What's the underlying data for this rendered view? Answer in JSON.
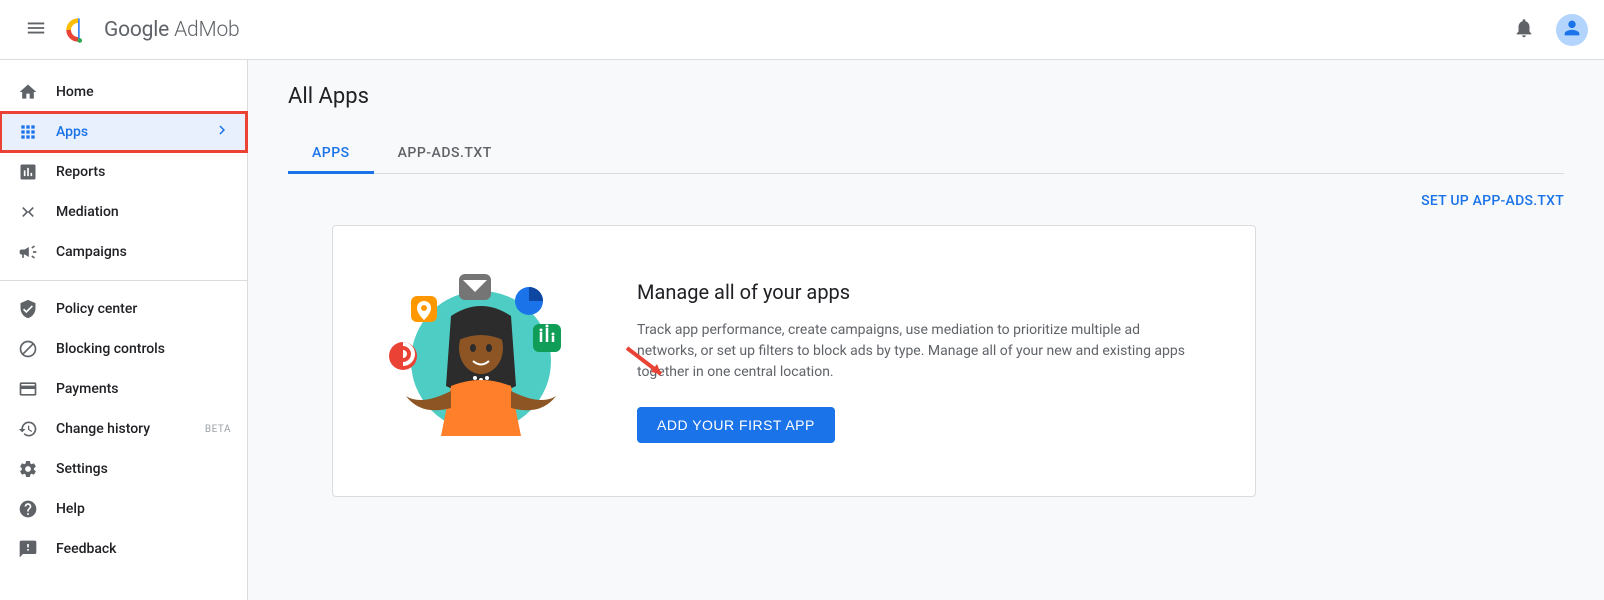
{
  "header": {
    "product_name_a": "Google",
    "product_name_b": "AdMob"
  },
  "sidebar": {
    "items": [
      {
        "label": "Home"
      },
      {
        "label": "Apps"
      },
      {
        "label": "Reports"
      },
      {
        "label": "Mediation"
      },
      {
        "label": "Campaigns"
      },
      {
        "label": "Policy center"
      },
      {
        "label": "Blocking controls"
      },
      {
        "label": "Payments"
      },
      {
        "label": "Change history",
        "badge": "BETA"
      },
      {
        "label": "Settings"
      },
      {
        "label": "Help"
      },
      {
        "label": "Feedback"
      }
    ]
  },
  "main": {
    "title": "All Apps",
    "tabs": [
      {
        "label": "APPS"
      },
      {
        "label": "APP-ADS.TXT"
      }
    ],
    "setup_link": "SET UP APP-ADS.TXT",
    "card": {
      "heading": "Manage all of your apps",
      "body": "Track app performance, create campaigns, use mediation to prioritize multiple ad networks, or set up filters to block ads by type. Manage all of your new and existing apps together in one central location.",
      "cta": "ADD YOUR FIRST APP"
    }
  }
}
